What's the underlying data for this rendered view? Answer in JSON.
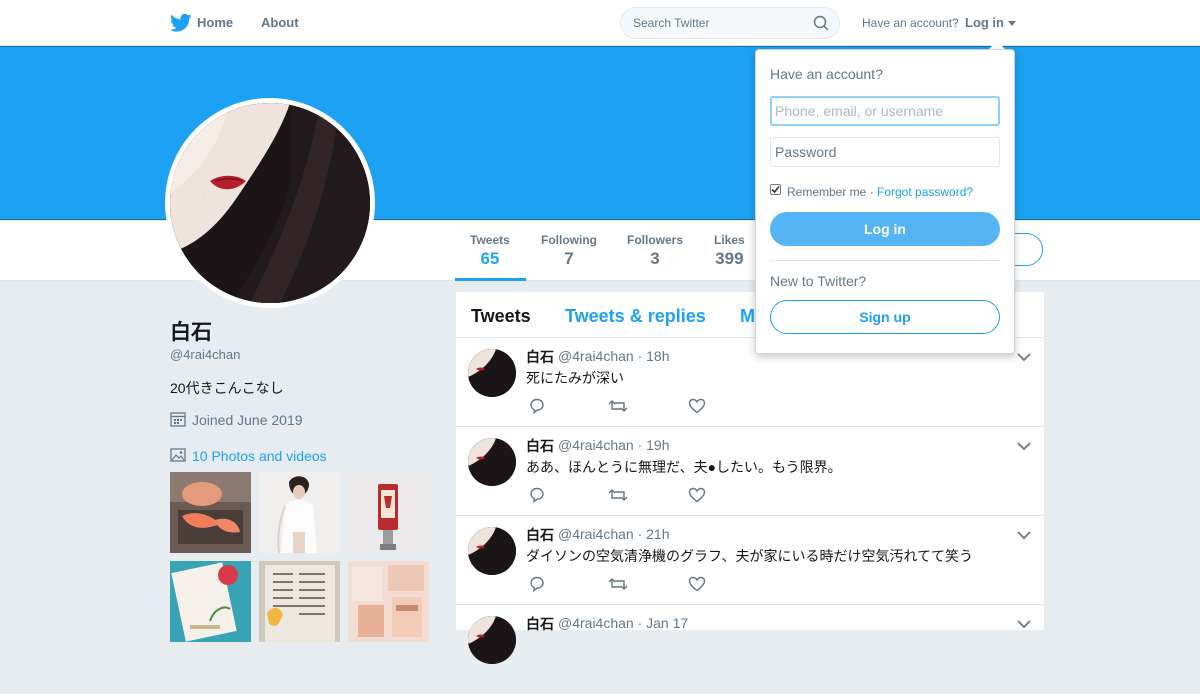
{
  "topnav": {
    "home_label": "Home",
    "about_label": "About",
    "search_placeholder": "Search Twitter",
    "have_account": "Have an account?",
    "login_label": "Log in"
  },
  "colors": {
    "accent": "#1da1f2",
    "banner": "#1da1f2",
    "muted": "#657786"
  },
  "profile": {
    "name": "白石",
    "handle": "@4rai4chan",
    "bio": "20代きこんこなし",
    "joined": "Joined June 2019",
    "photos_link": "10 Photos and videos"
  },
  "stats": [
    {
      "label": "Tweets",
      "value": "65",
      "active": true
    },
    {
      "label": "Following",
      "value": "7"
    },
    {
      "label": "Followers",
      "value": "3"
    },
    {
      "label": "Likes",
      "value": "399"
    }
  ],
  "timeline": {
    "tabs": [
      {
        "label": "Tweets",
        "active": true
      },
      {
        "label": "Tweets & replies"
      },
      {
        "label": "M"
      }
    ],
    "tweets": [
      {
        "name": "白石",
        "handle": "@4rai4chan · 18h",
        "text": "死にたみが深い"
      },
      {
        "name": "白石",
        "handle": "@4rai4chan · 19h",
        "text": "ああ、ほんとうに無理だ、夫●したい。もう限界。"
      },
      {
        "name": "白石",
        "handle": "@4rai4chan · 21h",
        "text": "ダイソンの空気清浄機のグラフ、夫が家にいる時だけ空気汚れてて笑う"
      },
      {
        "name": "白石",
        "handle": "@4rai4chan · Jan 17",
        "text": ""
      }
    ]
  },
  "login_dropdown": {
    "title": "Have an account?",
    "username_placeholder": "Phone, email, or username",
    "password_placeholder": "Password",
    "remember_label": "Remember me ·",
    "forgot_label": "Forgot password?",
    "login_button": "Log in",
    "new_label": "New to Twitter?",
    "signup_button": "Sign up"
  }
}
